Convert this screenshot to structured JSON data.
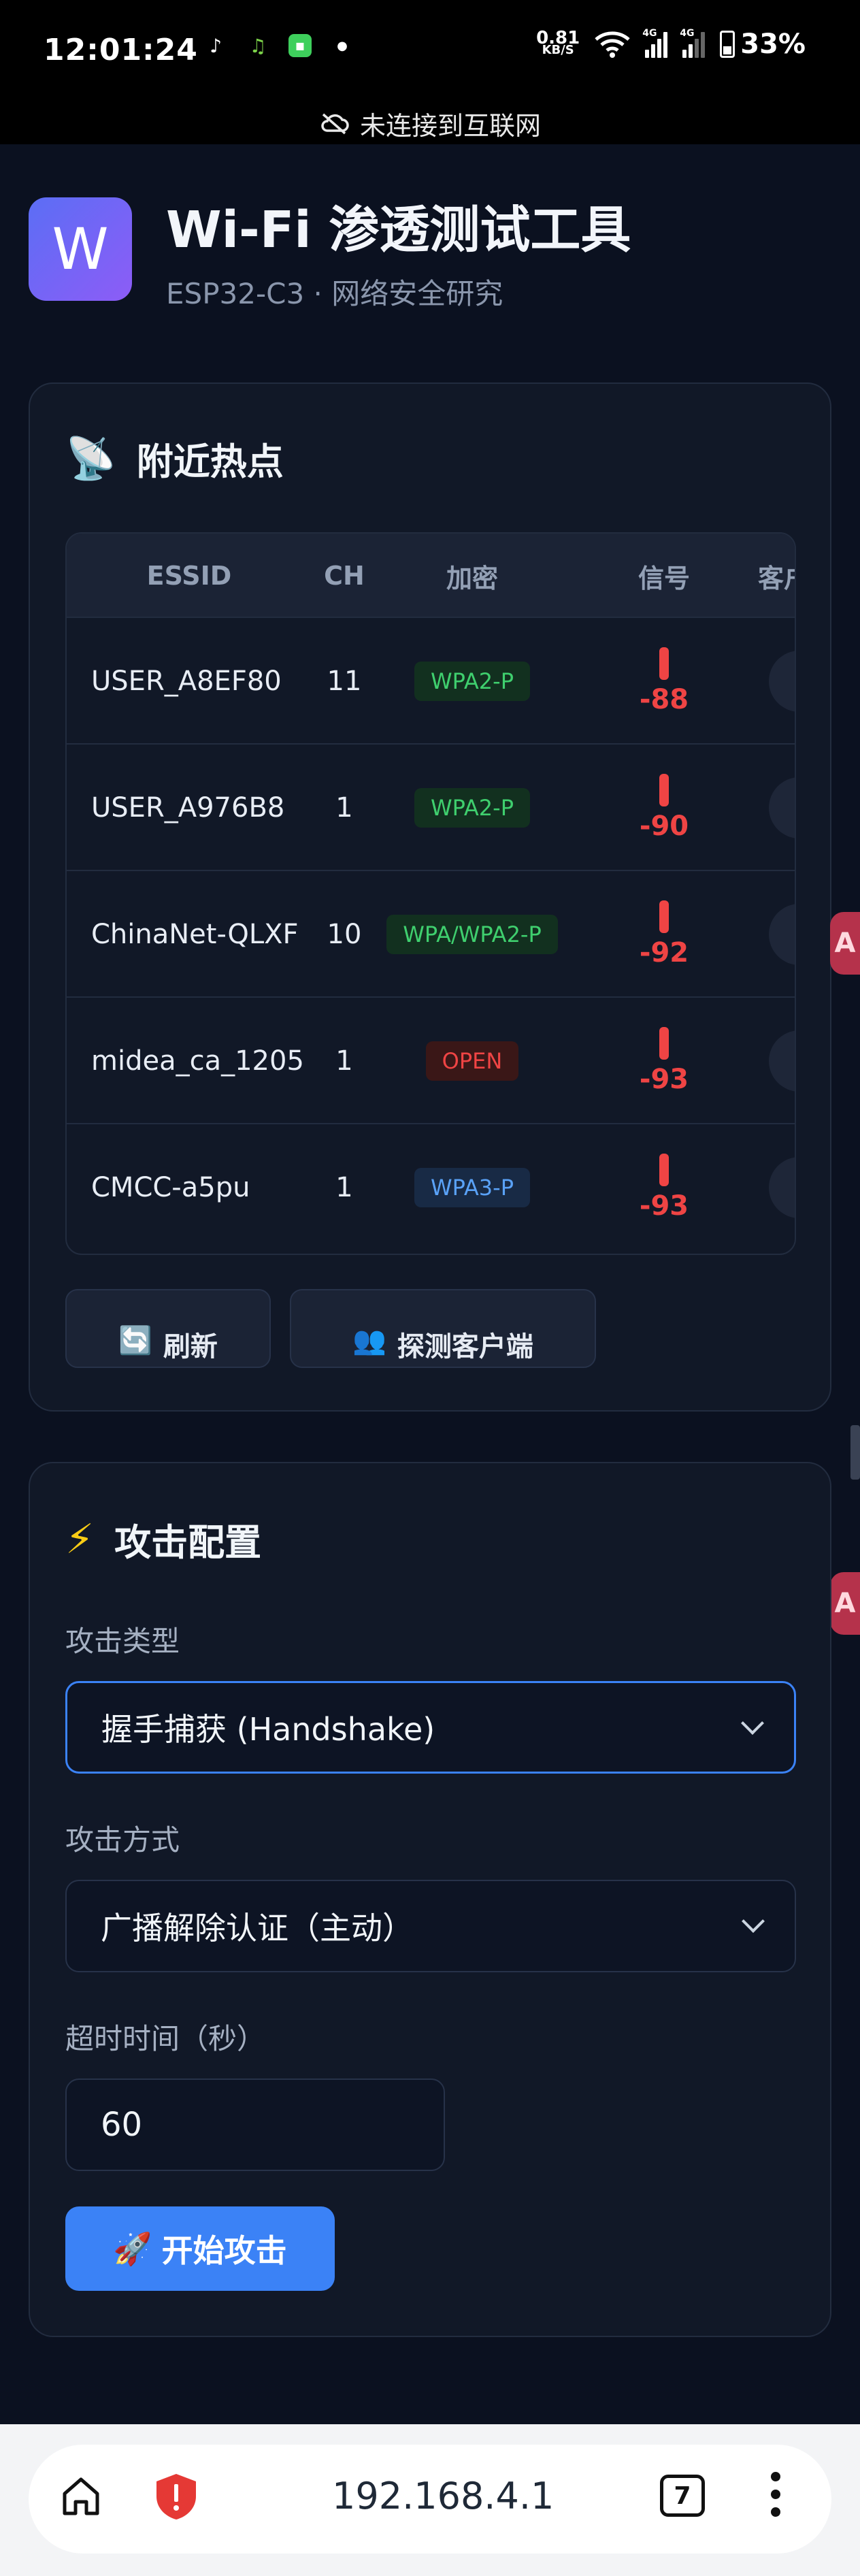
{
  "status_bar": {
    "time": "12:01:24",
    "speed_value": "0.81",
    "speed_unit": "KB/S",
    "net1": "4G",
    "net2": "4G",
    "battery": "33%",
    "offline_text": "未连接到互联网"
  },
  "header": {
    "logo_letter": "W",
    "title": "Wi-Fi 渗透测试工具",
    "subtitle": "ESP32-C3 · 网络安全研究"
  },
  "hotspots": {
    "title": "附近热点",
    "icon": "satellite-antenna-icon",
    "columns": [
      "ESSID",
      "CH",
      "加密",
      "信号",
      "客户"
    ],
    "rows": [
      {
        "essid": "USER_A8EF80",
        "ch": "11",
        "enc": "WPA2-P",
        "enc_type": "wpa2",
        "signal": "-88"
      },
      {
        "essid": "USER_A976B8",
        "ch": "1",
        "enc": "WPA2-P",
        "enc_type": "wpa2",
        "signal": "-90"
      },
      {
        "essid": "ChinaNet-QLXF",
        "ch": "10",
        "enc": "WPA/WPA2-P",
        "enc_type": "wpa2",
        "signal": "-92"
      },
      {
        "essid": "midea_ca_1205",
        "ch": "1",
        "enc": "OPEN",
        "enc_type": "open",
        "signal": "-93"
      },
      {
        "essid": "CMCC-a5pu",
        "ch": "1",
        "enc": "WPA3-P",
        "enc_type": "wpa3",
        "signal": "-93"
      }
    ],
    "refresh_label": "刷新",
    "probe_label": "探测客户端"
  },
  "attack": {
    "title": "攻击配置",
    "icon": "lightning-icon",
    "type_label": "攻击类型",
    "type_value": "握手捕获 (Handshake)",
    "method_label": "攻击方式",
    "method_value": "广播解除认证（主动）",
    "timeout_label": "超时时间（秒）",
    "timeout_value": "60",
    "start_label": "开始攻击"
  },
  "browser": {
    "url": "192.168.4.1",
    "tab_count": "7"
  },
  "colors": {
    "accent": "#3b82f6",
    "page_bg": "#0b1120",
    "card_bg": "#111827",
    "danger": "#ef4444",
    "success": "#3fcf6e"
  }
}
